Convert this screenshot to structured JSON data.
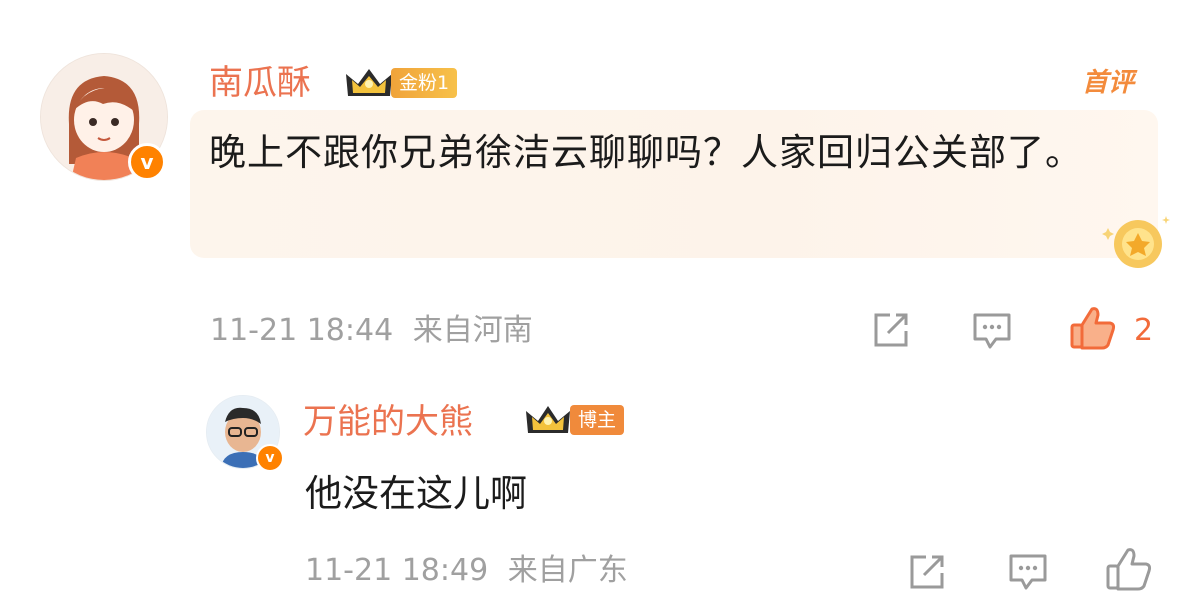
{
  "comment": {
    "username": "南瓜酥",
    "fan_tag": "金粉1",
    "first_label": "首评",
    "text": "晚上不跟你兄弟徐洁云聊聊吗？人家回归公关部了。",
    "time": "11-21 18:44",
    "location": "来自河南",
    "like_count": "2",
    "liked": true
  },
  "reply": {
    "username": "万能的大熊",
    "role_tag": "博主",
    "text": "他没在这儿啊",
    "time": "11-21 18:49",
    "location": "来自广东"
  },
  "colors": {
    "username": "#eb7350",
    "accent": "#ff8200",
    "meta": "#a0a0a0",
    "like_active": "#f26b3a"
  },
  "icons": [
    "verified-v-icon",
    "crown-icon",
    "share-icon",
    "comment-icon",
    "like-icon"
  ]
}
